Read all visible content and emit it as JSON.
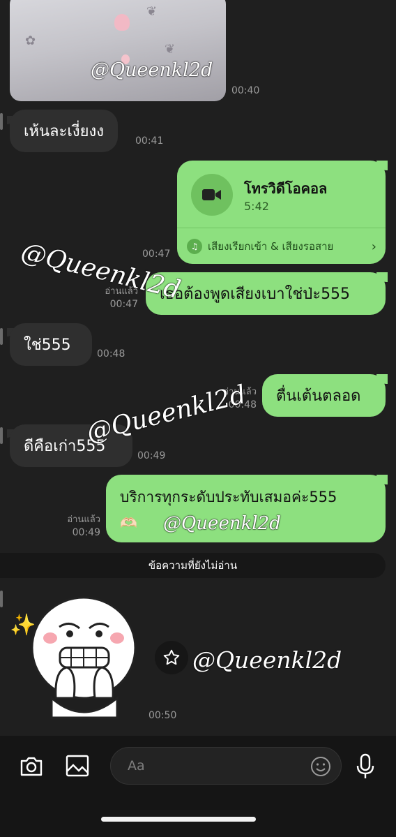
{
  "watermark": "@Queenkl2d",
  "photo_message": {
    "time": "00:40"
  },
  "messages": [
    {
      "dir": "in",
      "text": "เห้นละเงี่ยงง",
      "time": "00:41"
    },
    {
      "dir": "out",
      "text": "เธอต้องพูดเสียงเบาใช่ป่ะ555",
      "read": "อ่านแล้ว",
      "time": "00:47"
    },
    {
      "dir": "in",
      "text": "ใช่555",
      "time": "00:48"
    },
    {
      "dir": "out",
      "text": "ตื่นเต้นตลอด",
      "read": "อ่านแล้ว",
      "time": "00:48"
    },
    {
      "dir": "in",
      "text": "ดีคือเก่า555",
      "time": "00:49"
    },
    {
      "dir": "out",
      "text": "บริการทุกระดับประทับเสมอค่ะ555",
      "emoji": "🫶🏻",
      "read": "อ่านแล้ว",
      "time": "00:49"
    }
  ],
  "video_call": {
    "title": "โทรวิดีโอคอล",
    "duration": "5:42",
    "time": "00:47",
    "sound_label": "เสียงเรียกเข้า & เสียงรอสาย"
  },
  "unread_label": "ข้อความที่ยังไม่อ่าน",
  "sticker_message": {
    "time": "00:50",
    "star_icon": "star-outline-icon",
    "sparkle": "✨"
  },
  "composer": {
    "placeholder": "Aa",
    "icons": [
      "camera-icon",
      "image-icon",
      "emoji-icon",
      "microphone-icon"
    ]
  },
  "colors": {
    "outgoing_bubble": "#8de07f",
    "incoming_bubble": "#2f2f2f",
    "background": "#1f1f1f"
  }
}
